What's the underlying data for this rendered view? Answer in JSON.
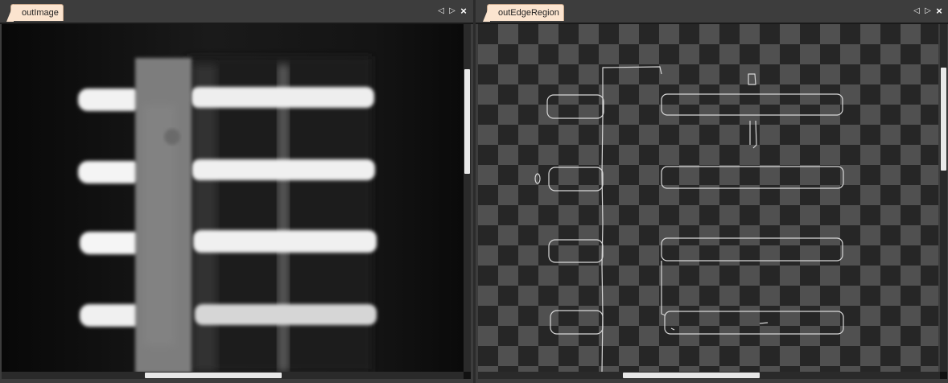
{
  "left_panel": {
    "tab_label": "outImage"
  },
  "right_panel": {
    "tab_label": "outEdgeRegion"
  },
  "controls": {
    "prev_glyph": "◁",
    "next_glyph": "▷",
    "close_glyph": "×"
  },
  "icons": {
    "prev": "triangle-left-icon",
    "next": "triangle-right-icon",
    "close": "close-icon"
  }
}
